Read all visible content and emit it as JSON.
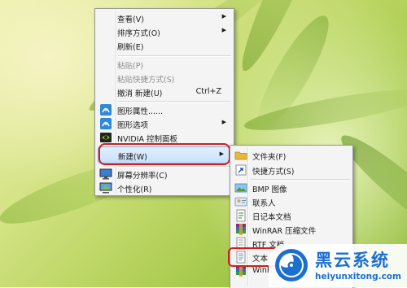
{
  "context_menu": {
    "items": [
      {
        "label": "查看(V)"
      },
      {
        "label": "排序方式(O)"
      },
      {
        "label": "刷新(E)"
      },
      {
        "label": "粘贴(P)"
      },
      {
        "label": "粘贴快捷方式(S)"
      },
      {
        "label": "撤消 新建(U)",
        "shortcut": "Ctrl+Z"
      },
      {
        "label": "图形属性......"
      },
      {
        "label": "图形选项"
      },
      {
        "label": "NVIDIA 控制面板"
      },
      {
        "label": "新建(W)"
      },
      {
        "label": "屏幕分辨率(C)"
      },
      {
        "label": "个性化(R)"
      }
    ]
  },
  "new_submenu": {
    "items": [
      {
        "label": "文件夹(F)"
      },
      {
        "label": "快捷方式(S)"
      },
      {
        "label": "BMP 图像"
      },
      {
        "label": "联系人"
      },
      {
        "label": "日记本文档"
      },
      {
        "label": "WinRAR 压缩文件"
      },
      {
        "label": "RTF 文档"
      },
      {
        "label": "文本"
      },
      {
        "label": "WinR"
      }
    ]
  },
  "watermark": {
    "title": "黑云系统",
    "url": "heiyunxitong.com"
  }
}
